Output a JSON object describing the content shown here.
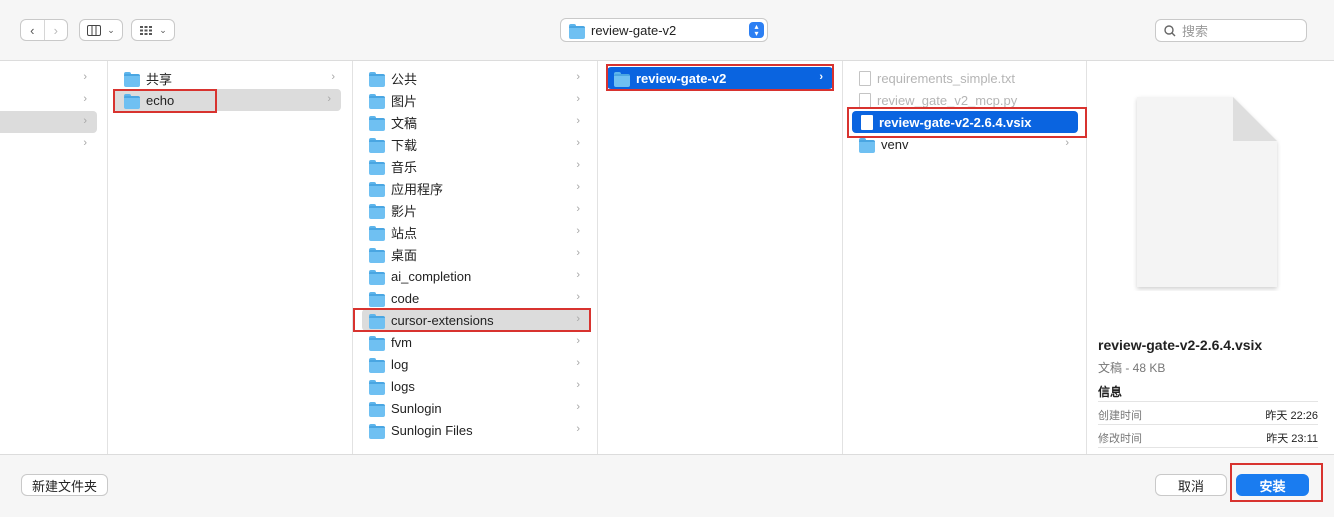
{
  "toolbar": {
    "back_icon": "‹",
    "forward_icon": "›",
    "path_folder": "review-gate-v2",
    "search_placeholder": "搜索"
  },
  "columns": {
    "sidebar": [
      {
        "label": "",
        "arrow": "›"
      },
      {
        "label": "",
        "arrow": "›"
      },
      {
        "label": "",
        "arrow": "›"
      },
      {
        "label": "",
        "arrow": "›"
      }
    ],
    "users": [
      {
        "label": "共享"
      },
      {
        "label": "echo"
      }
    ],
    "home": [
      {
        "label": "公共"
      },
      {
        "label": "图片"
      },
      {
        "label": "文稿"
      },
      {
        "label": "下载"
      },
      {
        "label": "音乐"
      },
      {
        "label": "应用程序"
      },
      {
        "label": "影片"
      },
      {
        "label": "站点"
      },
      {
        "label": "桌面"
      },
      {
        "label": "ai_completion"
      },
      {
        "label": "code"
      },
      {
        "label": "cursor-extensions"
      },
      {
        "label": "fvm"
      },
      {
        "label": "log"
      },
      {
        "label": "logs"
      },
      {
        "label": "Sunlogin"
      },
      {
        "label": "Sunlogin Files"
      }
    ],
    "extensions": [
      {
        "label": "review-gate-v2"
      }
    ],
    "files": [
      {
        "label": "requirements_simple.txt"
      },
      {
        "label": "review_gate_v2_mcp.py"
      },
      {
        "label": "review-gate-v2-2.6.4.vsix"
      },
      {
        "label": "venv"
      }
    ]
  },
  "preview": {
    "filename": "review-gate-v2-2.6.4.vsix",
    "kind": "文稿 - 48 KB",
    "info_title": "信息",
    "created_label": "创建时间",
    "created_value": "昨天 22:26",
    "modified_label": "修改时间",
    "modified_value": "昨天 23:11"
  },
  "bottom": {
    "new_folder": "新建文件夹",
    "cancel": "取消",
    "install": "安装"
  }
}
